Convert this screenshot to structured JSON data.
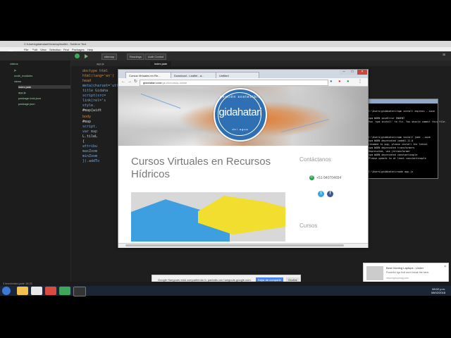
{
  "google_logo": "Google",
  "editor": {
    "title": "C:\\Users\\gidahatari\\Desktop\\leaflet - Sublime Text",
    "menu": [
      "File",
      "Edit",
      "View",
      "Selection",
      "Find",
      "Packages",
      "Help"
    ],
    "toolbar_buttons": [
      "sitemap",
      "Readings",
      "Auth Control"
    ],
    "tabs": [
      "app.js",
      "index.jade"
    ],
    "tree": [
      "videos",
      "js",
      "node_modules",
      "views",
      "index.jade",
      "app.js",
      "package-lock.json",
      "package.json"
    ],
    "code": [
      "doctype html",
      "html(lang='en')",
      "  head",
      "    meta(charset='utf-8')",
      "    title Gidaha",
      "    script(src=",
      "    link(rel='s",
      "    style.",
      "      #map{widt",
      "  body",
      "    #map",
      "    script.",
      "      var map",
      "      L.tileL",
      "      {",
      "        attribu",
      "        maxZoom",
      "        minZoom",
      "      }).addTo"
    ],
    "status": "3 lines\\index.jade  18:21"
  },
  "terminal": {
    "lines": [
      "C:\\Users\\gidahatari>npm install express --save",
      "...",
      "npm WARN saveError ENOENT",
      "Run 'npm install' to fix. You should commit this file.",
      "",
      "C:\\Users\\gidahatari>npm install jade --save",
      "npm WARN deprecated jade@1.11.0",
      "renamed to pug, please install the latest",
      "",
      "npm WARN deprecated transformers",
      "Deprecated, use jstransformer",
      "npm WARN deprecated constantinople",
      "Please update to at least constantinople",
      "",
      "C:\\Users\\gidahatari>node app.js"
    ]
  },
  "browser": {
    "tabs": [
      "Cursos Virtuales en Re...",
      "Download - Leaflet - a...",
      "Untitled"
    ],
    "url_host": "gidahatari.com",
    "url_path": "/ge-es/cursos-online",
    "hero_logo_text": "gidahatari",
    "logo_top": "gestión sostenible",
    "logo_bottom": "del agua",
    "page_title": "Cursos Virtuales en Recursos Hídricos",
    "contact_heading": "Contáctanos",
    "phone": "+51-940704654",
    "cursos_heading": "Cursos"
  },
  "share_bar": {
    "text": "Google Hangouts está compartiendo tu pantalla con hangouts.google.com.",
    "stop_label": "Dejar de compartir",
    "hide_label": "Ocultar"
  },
  "notification": {
    "title": "Best Gaming Laptops - Under",
    "body": "Powerful rigs that won't break the bank.",
    "site": "www.laptopmag.com"
  },
  "clock": {
    "time": "08:02 p.m.",
    "date": "08/02/2018"
  },
  "colors": {
    "logo_blue": "#2f70b5",
    "accent_orange": "#e27b33",
    "share_button": "#4a86e8"
  }
}
